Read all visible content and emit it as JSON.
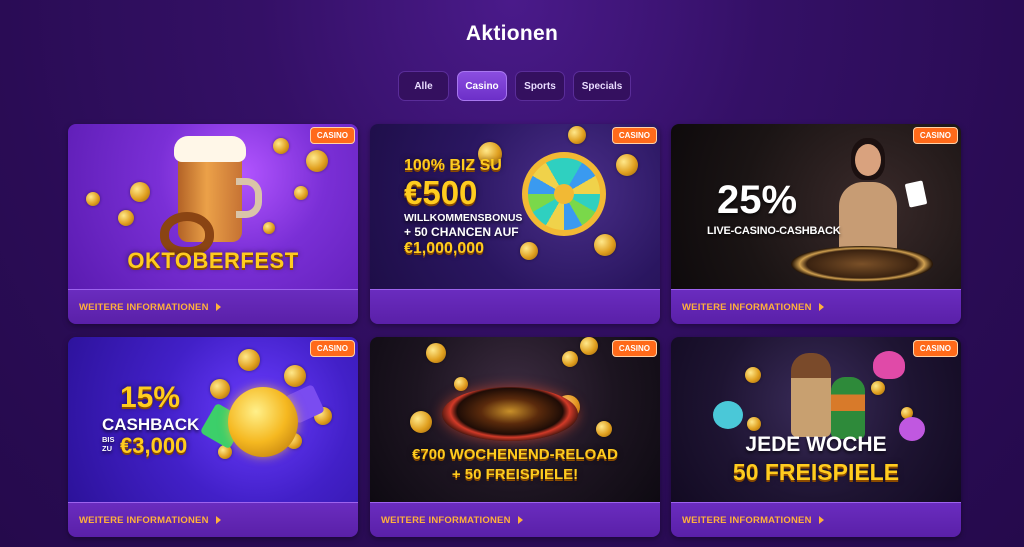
{
  "page": {
    "title": "Aktionen"
  },
  "tabs": [
    {
      "label": "Alle",
      "active": false
    },
    {
      "label": "Casino",
      "active": true
    },
    {
      "label": "Sports",
      "active": false
    },
    {
      "label": "Specials",
      "active": false
    }
  ],
  "cards": [
    {
      "badge": "CASINO",
      "more_label": "WEITERE INFORMATIONEN",
      "banner": {
        "line1": "OKTOBERFEST"
      }
    },
    {
      "badge": "CASINO",
      "more_label": "",
      "banner": {
        "line1": "100% BIZ SU",
        "line2": "€500",
        "line3": "WILLKOMMENSBONUS",
        "line4": "+ 50 CHANCEN AUF",
        "line5": "€1,000,000"
      }
    },
    {
      "badge": "CASINO",
      "more_label": "WEITERE INFORMATIONEN",
      "banner": {
        "line1": "25%",
        "line2": "LIVE-CASINO-CASHBACK"
      }
    },
    {
      "badge": "CASINO",
      "more_label": "WEITERE INFORMATIONEN",
      "banner": {
        "line1": "15%",
        "line2": "CASHBACK",
        "line3": "BIS ZU",
        "line4": "€3,000"
      }
    },
    {
      "badge": "CASINO",
      "more_label": "WEITERE INFORMATIONEN",
      "banner": {
        "line1": "€700 WOCHENEND-RELOAD",
        "line2": "+ 50 FREISPIELE!"
      }
    },
    {
      "badge": "CASINO",
      "more_label": "WEITERE INFORMATIONEN",
      "banner": {
        "line1": "JEDE WOCHE",
        "line2": "50 FREISPIELE"
      }
    }
  ]
}
